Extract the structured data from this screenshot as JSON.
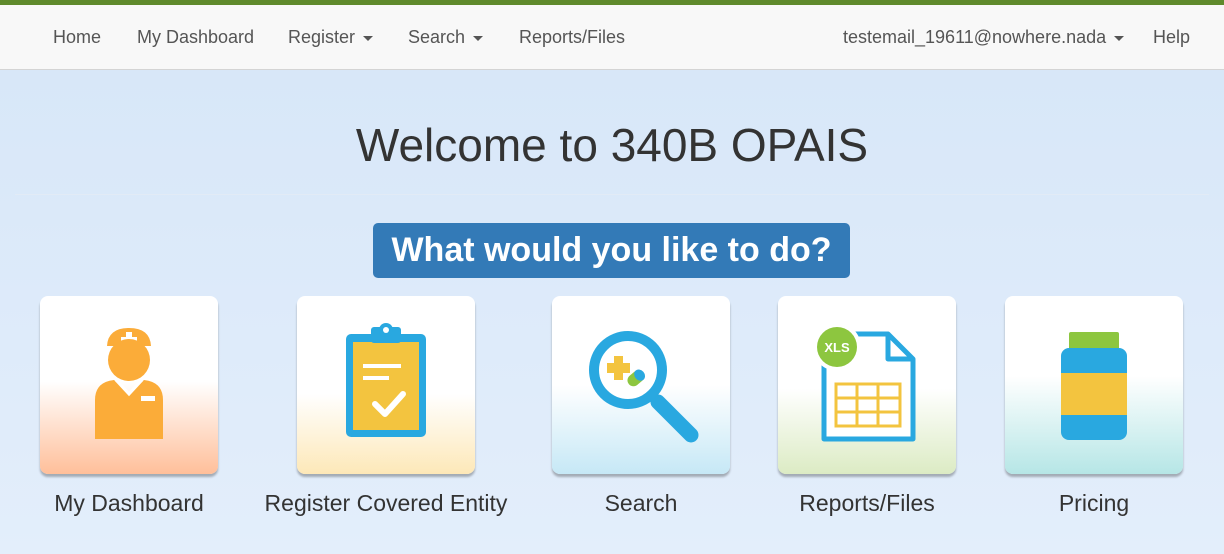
{
  "nav": {
    "home": "Home",
    "dashboard": "My Dashboard",
    "register": "Register",
    "search": "Search",
    "reports": "Reports/Files",
    "user": "testemail_19611@nowhere.nada",
    "help": "Help"
  },
  "main": {
    "title": "Welcome to 340B OPAIS",
    "prompt": "What would you like to do?"
  },
  "tiles": [
    {
      "label": "My Dashboard",
      "icon": "nurse-icon",
      "gradient": "#ffbf9a"
    },
    {
      "label": "Register Covered Entity",
      "icon": "clipboard-check-icon",
      "gradient": "#fde8b8"
    },
    {
      "label": "Search",
      "icon": "magnifier-icon",
      "gradient": "#c6e8f6"
    },
    {
      "label": "Reports/Files",
      "icon": "xls-file-icon",
      "icon_badge": "XLS",
      "gradient": "#dcebc4"
    },
    {
      "label": "Pricing",
      "icon": "pill-bottle-icon",
      "gradient": "#b6e6e6"
    }
  ],
  "colors": {
    "accent_bar": "#5f8a2c",
    "banner": "#337ab7",
    "orange": "#fbac39",
    "yellow": "#f3c43f",
    "blue": "#29a8e0",
    "green": "#8dc63f"
  }
}
